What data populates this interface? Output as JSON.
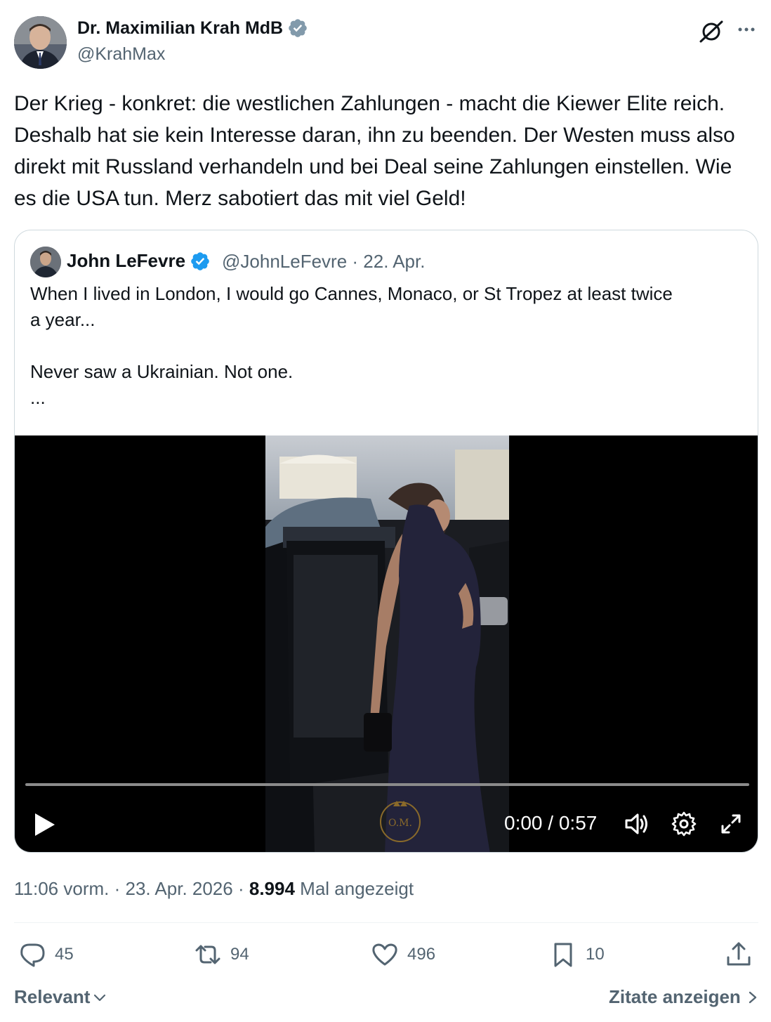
{
  "tweet": {
    "author_name": "Dr. Maximilian Krah MdB",
    "author_handle": "@KrahMax",
    "text": "Der Krieg - konkret: die westlichen Zahlungen - macht die Kiewer Elite reich. Deshalb hat sie kein Interesse daran, ihn zu beenden. Der Westen muss also direkt mit Russland verhandeln und bei Deal seine Zahlungen einstellen. Wie es die USA tun. Merz sabotiert das mit viel Geld!",
    "time": "11:06 vorm.",
    "date": "23. Apr. 2026",
    "views_count": "8.994",
    "views_label": "Mal angezeigt"
  },
  "quote": {
    "author_name": "John LeFevre",
    "author_handle": "@JohnLeFevre",
    "date": "22. Apr.",
    "lines": [
      "When I lived in London, I would go Cannes, Monaco, or St Tropez at least twice",
      "a year...",
      "",
      "Never saw a Ukrainian. Not one.",
      "..."
    ],
    "video": {
      "current_time": "0:00",
      "duration": "0:57",
      "progress": 0,
      "watermark": "O.M."
    }
  },
  "actions": {
    "replies": "45",
    "reposts": "94",
    "likes": "496",
    "bookmarks": "10"
  },
  "footer": {
    "sort_label": "Relevant",
    "quotes_link": "Zitate anzeigen"
  },
  "colors": {
    "verified": "#1d9bf0",
    "verified_gray": "#829aab",
    "secondary_text": "#536471",
    "border": "#cfd9de"
  }
}
